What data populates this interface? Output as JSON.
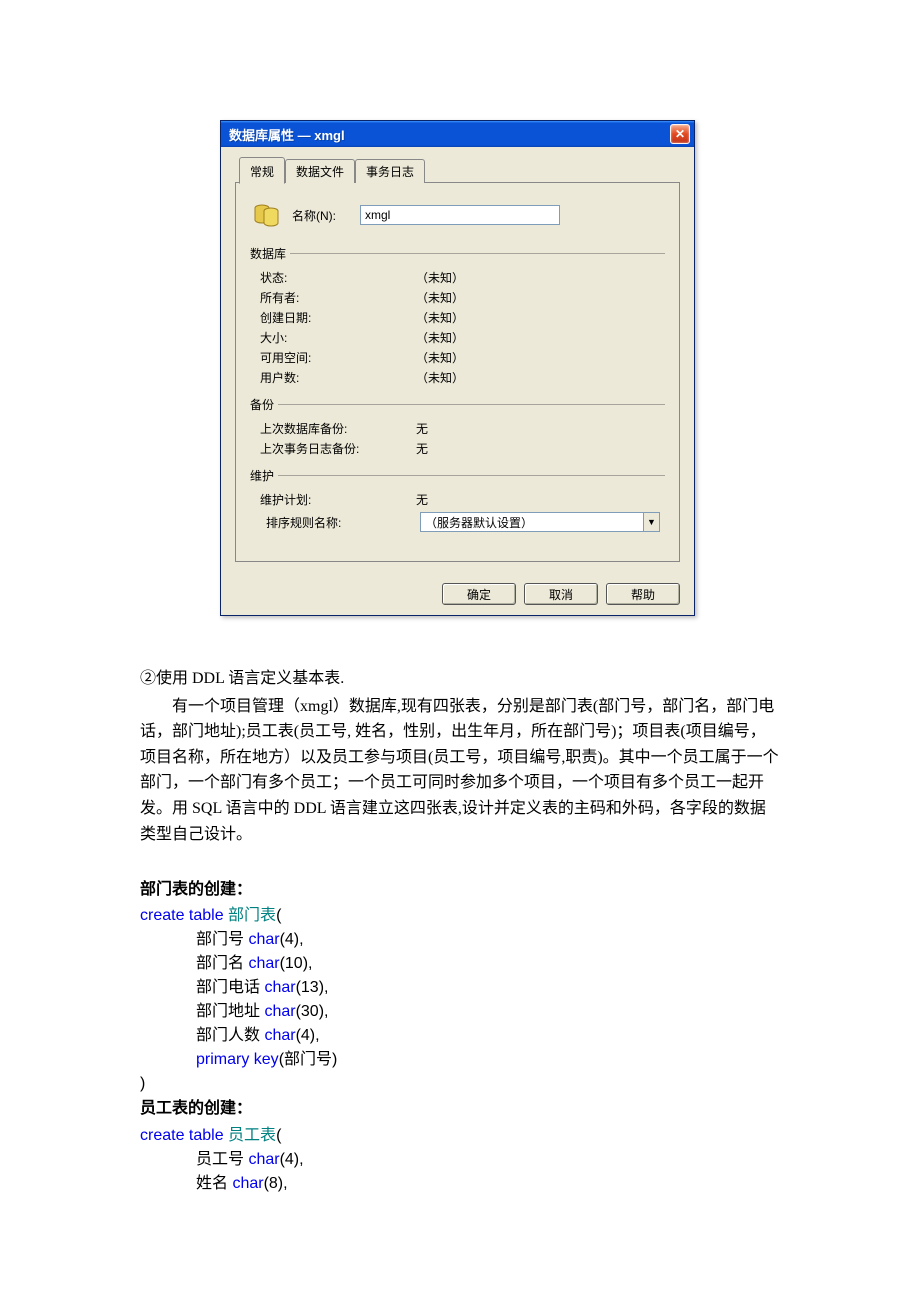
{
  "dialog": {
    "title": "数据库属性 — xmgl",
    "close_glyph": "✕",
    "tabs": {
      "general": "常规",
      "datafiles": "数据文件",
      "txlog": "事务日志"
    },
    "name_label": "名称(N):",
    "name_value": "xmgl",
    "section_database": "数据库",
    "db_rows": {
      "status_k": "状态:",
      "status_v": "（未知）",
      "owner_k": "所有者:",
      "owner_v": "（未知）",
      "created_k": "创建日期:",
      "created_v": "（未知）",
      "size_k": "大小:",
      "size_v": "（未知）",
      "free_k": "可用空间:",
      "free_v": "（未知）",
      "users_k": "用户数:",
      "users_v": "（未知）"
    },
    "section_backup": "备份",
    "backup_rows": {
      "lastdb_k": "上次数据库备份:",
      "lastdb_v": "无",
      "lastlog_k": "上次事务日志备份:",
      "lastlog_v": "无"
    },
    "section_maint": "维护",
    "maint_rows": {
      "plan_k": "维护计划:",
      "plan_v": "无",
      "collation_k": "排序规则名称:",
      "collation_v": "（服务器默认设置）"
    },
    "buttons": {
      "ok": "确定",
      "cancel": "取消",
      "help": "帮助"
    },
    "dropdown_glyph": "▼"
  },
  "doc": {
    "p_lead": "②使用 DDL 语言定义基本表.",
    "p_body1": "有一个项目管理（xmgl）数据库,现有四张表，分别是部门表(部门号，部门名，部门电话，部门地址);员工表(员工号, 姓名，性别，出生年月，所在部门号)；项目表(项目编号，项目名称，所在地方）以及员工参与项目(员工号，项目编号,职责)。其中一个员工属于一个部门，一个部门有多个员工；一个员工可同时参加多个项目，一个项目有多个员工一起开发。用 SQL 语言中的 DDL 语言建立这四张表,设计并定义表的主码和外码，各字段的数据类型自己设计。",
    "h_dept": "部门表的创建：",
    "h_emp": "员工表的创建：",
    "sql": {
      "create_table": "create table",
      "char": "char",
      "primary_key": "primary key",
      "dept_name": " 部门表",
      "emp_name": " 员工表",
      "open_paren": "(",
      "close_paren": ")",
      "dept_f1": "部门号 ",
      "dept_f1_t": "(4),",
      "dept_f2": "部门名 ",
      "dept_f2_t": "(10),",
      "dept_f3": "部门电话 ",
      "dept_f3_t": "(13),",
      "dept_f4": "部门地址 ",
      "dept_f4_t": "(30),",
      "dept_f5": "部门人数 ",
      "dept_f5_t": "(4),",
      "dept_pk": "(部门号)",
      "emp_f1": "员工号 ",
      "emp_f1_t": "(4),",
      "emp_f2": "姓名 ",
      "emp_f2_t": "(8),"
    }
  }
}
